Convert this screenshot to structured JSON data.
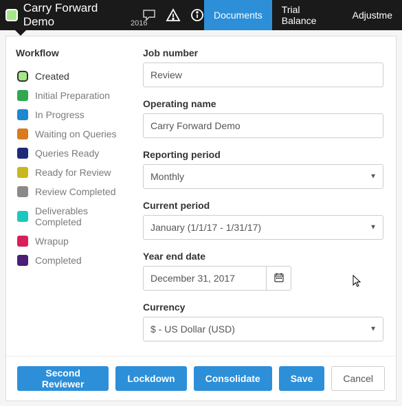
{
  "header": {
    "title": "Carry Forward Demo",
    "year": "2016",
    "tabs": [
      {
        "label": "Documents",
        "active": true
      },
      {
        "label": "Trial Balance",
        "active": false
      },
      {
        "label": "Adjustme",
        "active": false
      }
    ]
  },
  "sidebar": {
    "title": "Workflow",
    "items": [
      {
        "label": "Created",
        "color": "#a5e887",
        "selected": true
      },
      {
        "label": "Initial Preparation",
        "color": "#2fa84f",
        "selected": false
      },
      {
        "label": "In Progress",
        "color": "#1e88d2",
        "selected": false
      },
      {
        "label": "Waiting on Queries",
        "color": "#d97b1f",
        "selected": false
      },
      {
        "label": "Queries Ready",
        "color": "#1e2a78",
        "selected": false
      },
      {
        "label": "Ready for Review",
        "color": "#c8b81f",
        "selected": false
      },
      {
        "label": "Review Completed",
        "color": "#8a8a8a",
        "selected": false
      },
      {
        "label": "Deliverables Completed",
        "color": "#1cc7c0",
        "selected": false
      },
      {
        "label": "Wrapup",
        "color": "#d81e5b",
        "selected": false
      },
      {
        "label": "Completed",
        "color": "#4b1e78",
        "selected": false
      }
    ]
  },
  "form": {
    "job_number": {
      "label": "Job number",
      "value": "Review"
    },
    "operating_name": {
      "label": "Operating name",
      "value": "Carry Forward Demo"
    },
    "reporting_period": {
      "label": "Reporting period",
      "value": "Monthly"
    },
    "current_period": {
      "label": "Current period",
      "value": "January (1/1/17 - 1/31/17)"
    },
    "year_end_date": {
      "label": "Year end date",
      "value": "December 31, 2017"
    },
    "currency": {
      "label": "Currency",
      "value": "$ - US Dollar (USD)"
    }
  },
  "footer": {
    "second_reviewer": "Second Reviewer",
    "lockdown": "Lockdown",
    "consolidate": "Consolidate",
    "save": "Save",
    "cancel": "Cancel"
  }
}
